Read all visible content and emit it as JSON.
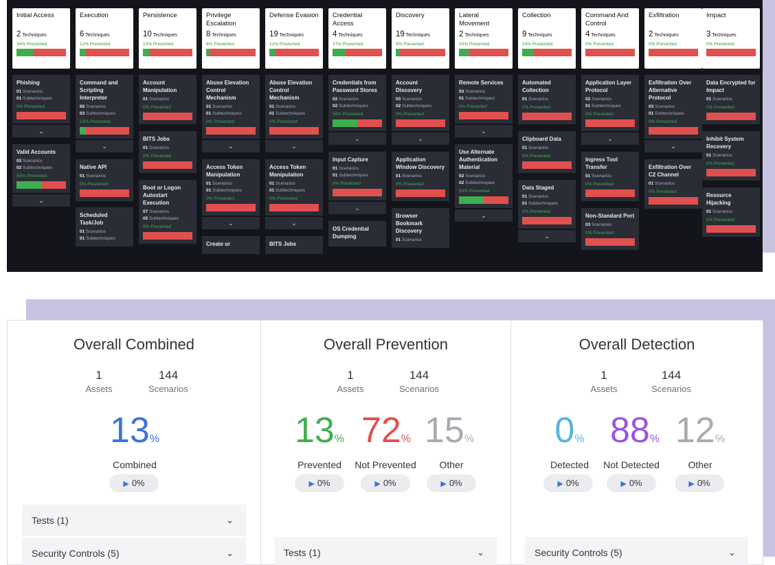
{
  "matrix": {
    "tactics": [
      {
        "name": "Initial Access",
        "count": "2",
        "unit": "Techniques",
        "prevented": "34% Prevented",
        "fill": 0.34
      },
      {
        "name": "Execution",
        "count": "6",
        "unit": "Techniques",
        "prevented": "12% Prevented",
        "fill": 0.12
      },
      {
        "name": "Persistence",
        "count": "10",
        "unit": "Techniques",
        "prevented": "13% Prevented",
        "fill": 0.13
      },
      {
        "name": "Privilege Escalation",
        "count": "8",
        "unit": "Techniques",
        "prevented": "6% Prevented",
        "fill": 0.06
      },
      {
        "name": "Defense Evasion",
        "count": "19",
        "unit": "Techniques",
        "prevented": "12% Prevented",
        "fill": 0.12
      },
      {
        "name": "Credential Access",
        "count": "4",
        "unit": "Techniques",
        "prevented": "27% Prevented",
        "fill": 0.27
      },
      {
        "name": "Discovery",
        "count": "19",
        "unit": "Techniques",
        "prevented": "9% Prevented",
        "fill": 0.09
      },
      {
        "name": "Lateral Movement",
        "count": "2",
        "unit": "Techniques",
        "prevented": "20% Prevented",
        "fill": 0.2
      },
      {
        "name": "Collection",
        "count": "9",
        "unit": "Techniques",
        "prevented": "23% Prevented",
        "fill": 0.23
      },
      {
        "name": "Command And Control",
        "count": "4",
        "unit": "Techniques",
        "prevented": "0% Prevented",
        "fill": 0
      },
      {
        "name": "Exfiltration",
        "count": "2",
        "unit": "Techniques",
        "prevented": "0% Prevented",
        "fill": 0
      },
      {
        "name": "Impact",
        "count": "3",
        "unit": "Techniques",
        "prevented": "0% Prevented",
        "fill": 0
      }
    ],
    "t": {
      "phishing": {
        "name": "Phishing",
        "l1n": "01",
        "l1": "Scenarios",
        "l2n": "01",
        "l2": "Subtechniques",
        "prev": "0% Prevented"
      },
      "valid": {
        "name": "Valid Accounts",
        "l1n": "02",
        "l1": "Scenarios",
        "l2n": "02",
        "l2": "Subtechniques",
        "prev": "50% Prevented"
      },
      "cmd": {
        "name": "Command and Scripting Interpreter",
        "l1n": "65",
        "l1": "Scenarios",
        "l2n": "03",
        "l2": "Subtechniques",
        "prev": "13% Prevented"
      },
      "native": {
        "name": "Native API",
        "l1n": "01",
        "l1": "Scenarios",
        "prev": "0% Prevented"
      },
      "sched": {
        "name": "Scheduled Task/Job",
        "l1n": "01",
        "l1": "Scenarios",
        "l2n": "01",
        "l2": "Subtechniques"
      },
      "acctmanip": {
        "name": "Account Manipulation",
        "l1n": "01",
        "l1": "Scenarios",
        "prev": "0% Prevented"
      },
      "bits1": {
        "name": "BITS Jobs",
        "l1n": "01",
        "l1": "Scenarios",
        "prev": "0% Prevented"
      },
      "boot": {
        "name": "Boot or Logon Autostart Execution",
        "l1n": "07",
        "l1": "Scenarios",
        "l2n": "05",
        "l2": "Subtechniques",
        "prev": "0% Prevented"
      },
      "abuse1": {
        "name": "Abuse Elevation Control Mechanism",
        "l1n": "01",
        "l1": "Scenarios",
        "l2n": "01",
        "l2": "Subtechniques",
        "prev": "0% Prevented"
      },
      "token1": {
        "name": "Access Token Manipulation",
        "l1n": "01",
        "l1": "Scenarios",
        "l2n": "01",
        "l2": "Subtechniques",
        "prev": "0% Prevented"
      },
      "createor": {
        "name": "Create or"
      },
      "abuse2": {
        "name": "Abuse Elevation Control Mechanism",
        "l1n": "01",
        "l1": "Scenarios",
        "l2n": "01",
        "l2": "Subtechniques",
        "prev": "0% Prevented"
      },
      "token2": {
        "name": "Access Token Manipulation",
        "l1n": "01",
        "l1": "Scenarios",
        "l2n": "01",
        "l2": "Subtechniques",
        "prev": "0% Prevented"
      },
      "bits2": {
        "name": "BITS Jobs"
      },
      "creds": {
        "name": "Credentials from Password Stores",
        "l1n": "02",
        "l1": "Scenarios",
        "l2n": "02",
        "l2": "Subtechniques",
        "prev": "50% Prevented"
      },
      "input": {
        "name": "Input Capture",
        "l1n": "01",
        "l1": "Scenarios",
        "l2n": "01",
        "l2": "Subtechniques",
        "prev": "0% Prevented"
      },
      "oscred": {
        "name": "OS Credential Dumping"
      },
      "acctdisc": {
        "name": "Account Discovery",
        "l1n": "03",
        "l1": "Scenarios",
        "l2n": "02",
        "l2": "Subtechniques",
        "prev": "0% Prevented"
      },
      "appwin": {
        "name": "Application Window Discovery",
        "l1n": "01",
        "l1": "Scenarios",
        "prev": "0% Prevented"
      },
      "browser": {
        "name": "Browser Bookmark Discovery",
        "l1n": "01",
        "l1": "Scenarios"
      },
      "remote": {
        "name": "Remote Services",
        "l1n": "03",
        "l1": "Scenarios",
        "l2n": "01",
        "l2": "Subtechniques",
        "prev": "0% Prevented"
      },
      "altauth": {
        "name": "Use Alternate Authentication Material",
        "l1n": "02",
        "l1": "Scenarios",
        "l2n": "02",
        "l2": "Subtechniques",
        "prev": "50% Prevented"
      },
      "autocoll": {
        "name": "Automated Collection",
        "l1n": "01",
        "l1": "Scenarios",
        "prev": "0% Prevented"
      },
      "clip": {
        "name": "Clipboard Data",
        "l1n": "01",
        "l1": "Scenarios",
        "prev": "0% Prevented"
      },
      "staged": {
        "name": "Data Staged",
        "l1n": "01",
        "l1": "Scenarios",
        "l2n": "01",
        "l2": "Subtechniques",
        "prev": "0% Prevented"
      },
      "applayer": {
        "name": "Application Layer Protocol",
        "l1n": "02",
        "l1": "Scenarios",
        "l2n": "01",
        "l2": "Subtechniques",
        "prev": "0% Prevented"
      },
      "ingress": {
        "name": "Ingress Tool Transfer",
        "l1n": "01",
        "l1": "Scenarios",
        "prev": "0% Prevented"
      },
      "nonstd": {
        "name": "Non-Standard Port",
        "l1n": "03",
        "l1": "Scenarios",
        "prev": "0% Prevented"
      },
      "exalt": {
        "name": "Exfiltration Over Alternative Protocol",
        "l1n": "03",
        "l1": "Scenarios",
        "l2n": "01",
        "l2": "Subtechniques",
        "prev": "0% Prevented"
      },
      "exc2": {
        "name": "Exfiltration Over C2 Channel",
        "l1n": "01",
        "l1": "Scenarios",
        "prev": "0% Prevented"
      },
      "encrypt": {
        "name": "Data Encrypted for Impact",
        "l1n": "01",
        "l1": "Scenarios",
        "prev": "0% Prevented"
      },
      "inhibit": {
        "name": "Inhibit System Recovery",
        "l1n": "01",
        "l1": "Scenarios",
        "prev": "0% Prevented"
      },
      "hijack": {
        "name": "Resource Hijacking",
        "l1n": "01",
        "l1": "Scenarios",
        "prev": "0% Prevented"
      }
    },
    "expand_glyph": "⌄"
  },
  "panels": {
    "combined": {
      "title": "Overall Combined",
      "assets_value": "1",
      "assets_label": "Assets",
      "scenarios_value": "144",
      "scenarios_label": "Scenarios",
      "big": "13",
      "big_unit": "%",
      "big_label": "Combined",
      "pill": "0%",
      "acc1": "Tests (1)",
      "acc2": "Security Controls (5)"
    },
    "prevention": {
      "title": "Overall Prevention",
      "assets_value": "1",
      "assets_label": "Assets",
      "scenarios_value": "144",
      "scenarios_label": "Scenarios",
      "prevented": "13",
      "prevented_label": "Prevented",
      "not_prevented": "72",
      "not_prevented_label": "Not Prevented",
      "other": "15",
      "other_label": "Other",
      "unit": "%",
      "pill": "0%",
      "acc1": "Tests (1)"
    },
    "detection": {
      "title": "Overall Detection",
      "assets_value": "1",
      "assets_label": "Assets",
      "scenarios_value": "144",
      "scenarios_label": "Scenarios",
      "detected": "0",
      "detected_label": "Detected",
      "not_detected": "88",
      "not_detected_label": "Not Detected",
      "other": "12",
      "other_label": "Other",
      "unit": "%",
      "pill": "0%",
      "acc1": "Security Controls (5)"
    },
    "pill_icon": "▶",
    "chevron": "⌄"
  },
  "colors": {
    "prevented": "#3fae4f",
    "not_prevented": "#e0504e",
    "combined": "#3b73d9",
    "detected": "#56b6de",
    "not_detected": "#9a55e0",
    "other": "#a9aab0"
  }
}
